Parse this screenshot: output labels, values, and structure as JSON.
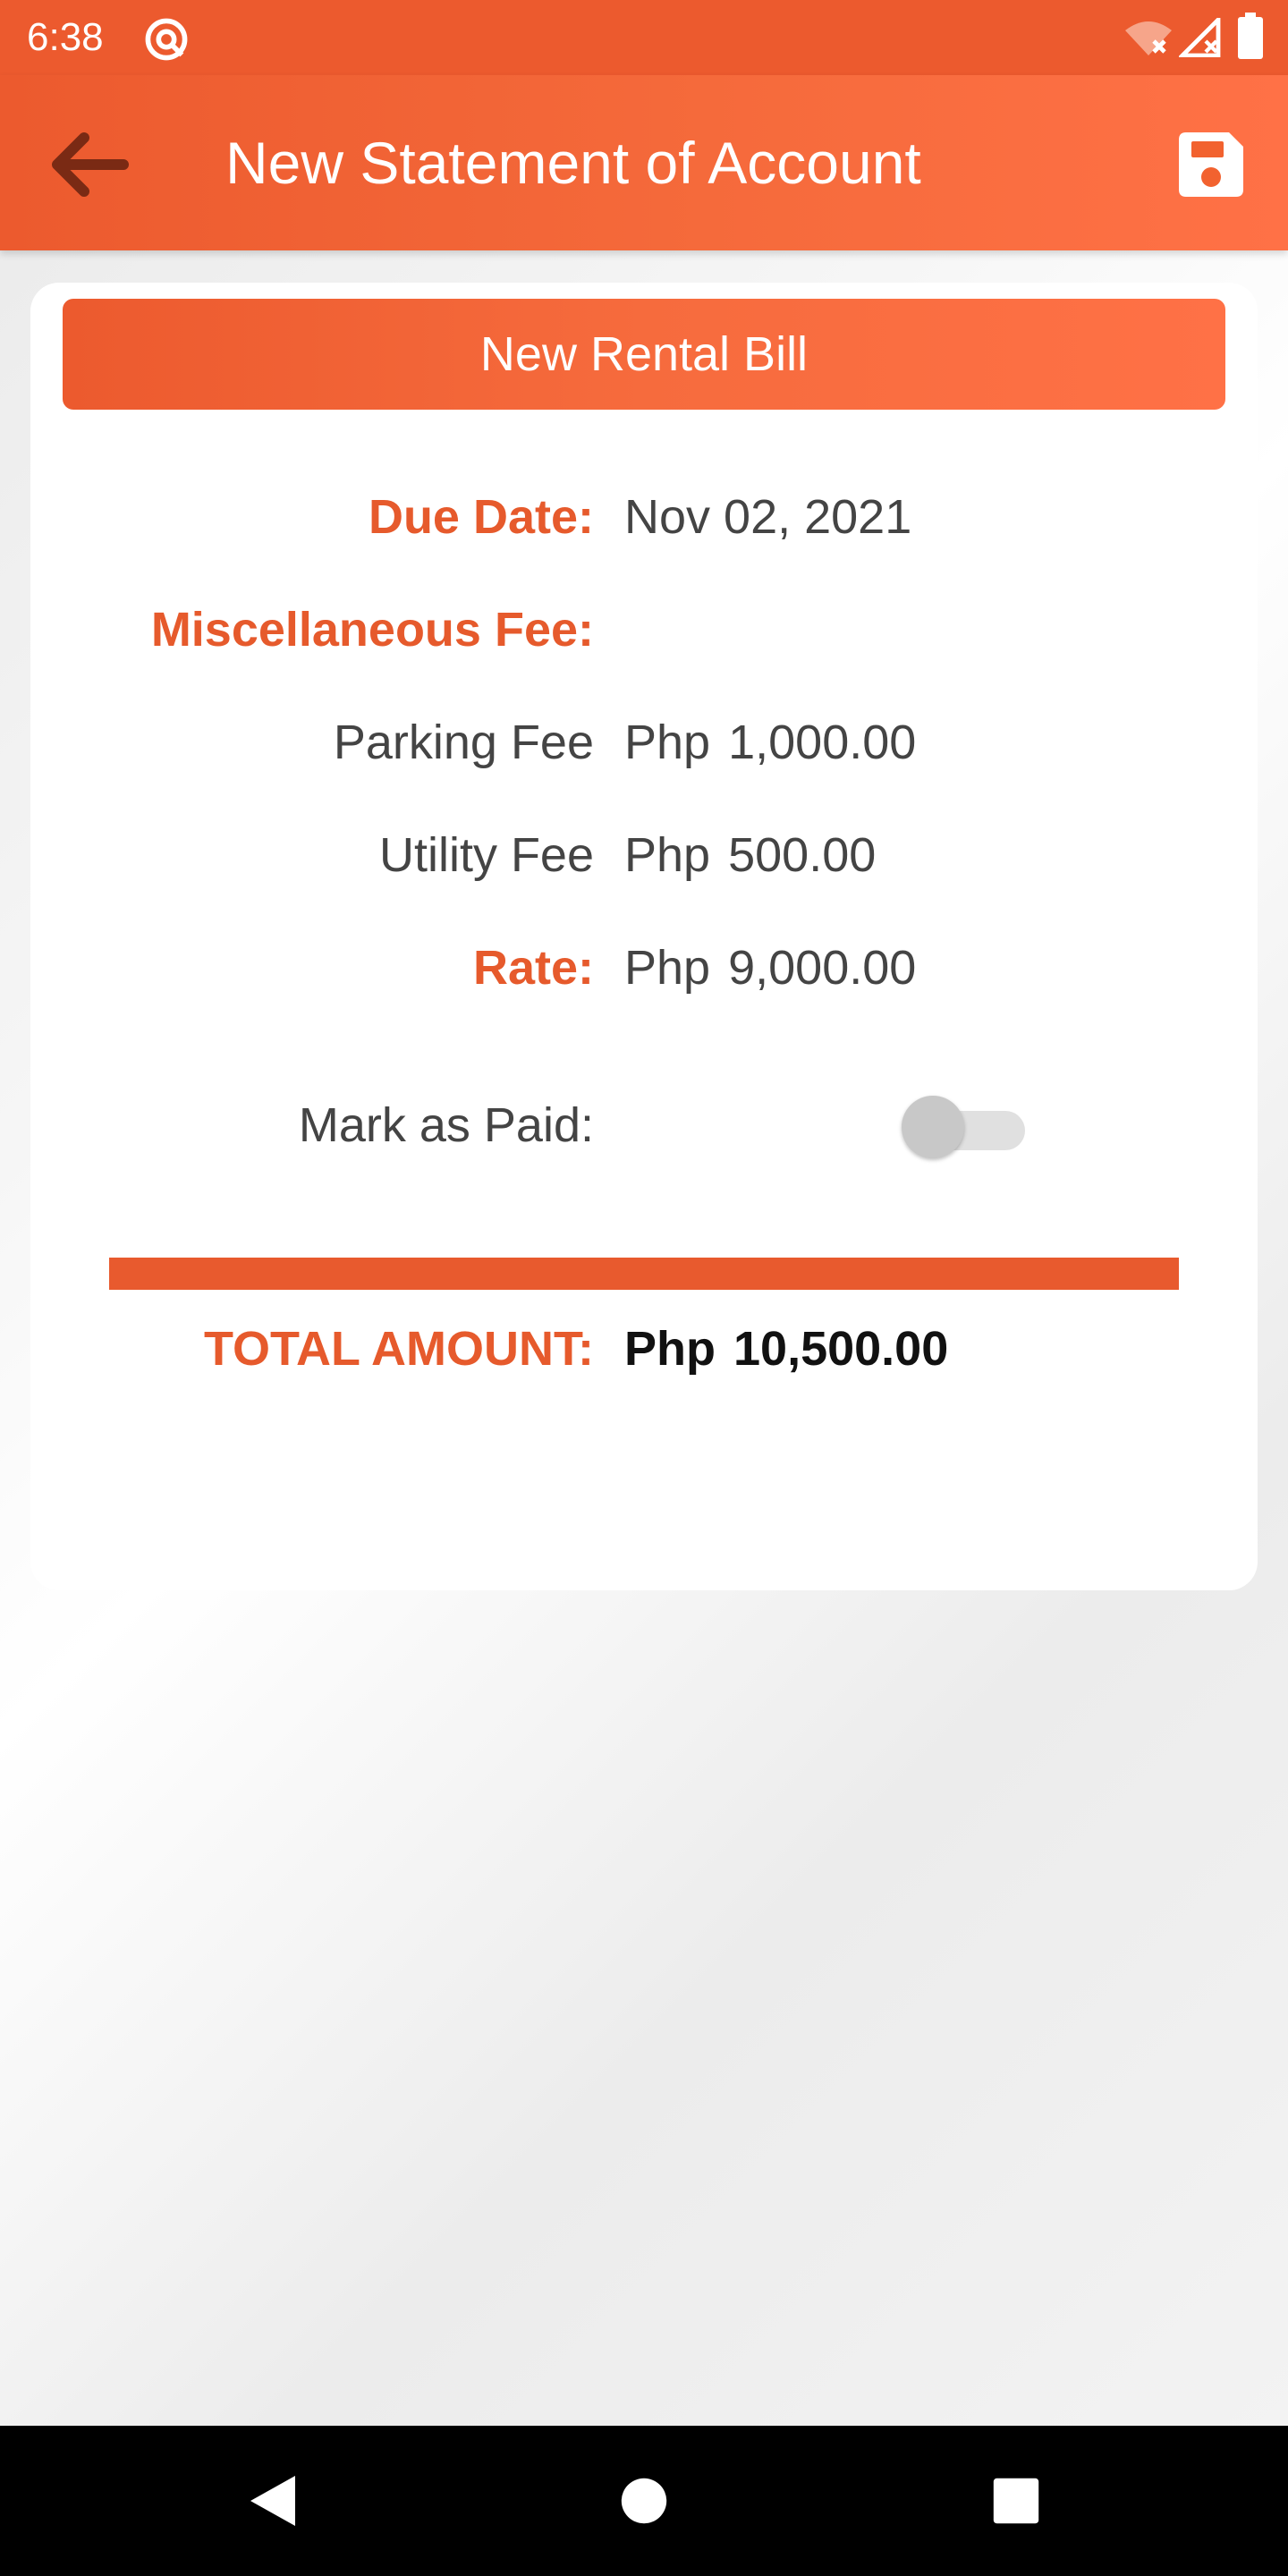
{
  "status_bar": {
    "time": "6:38",
    "app_icon": "at-sign-icon",
    "wifi_icon": "wifi-off-icon",
    "signal_icon": "signal-off-icon",
    "battery_icon": "battery-icon"
  },
  "app_bar": {
    "back_icon": "arrow-back-icon",
    "title": "New Statement of Account",
    "save_icon": "save-icon"
  },
  "bill": {
    "header_button": "New Rental Bill",
    "due_date_label": "Due Date:",
    "due_date_value": "Nov 02, 2021",
    "misc_fee_label": "Miscellaneous Fee:",
    "parking_fee_label": "Parking Fee",
    "parking_fee_currency": "Php",
    "parking_fee_amount": "1,000.00",
    "utility_fee_label": "Utility Fee",
    "utility_fee_currency": "Php",
    "utility_fee_amount": "500.00",
    "rate_label": "Rate:",
    "rate_currency": "Php",
    "rate_amount": "9,000.00",
    "mark_paid_label": "Mark as Paid:",
    "mark_paid": false,
    "total_label": "TOTAL AMOUNT:",
    "total_currency": "Php",
    "total_amount": "10,500.00"
  },
  "nav_bar": {
    "back": "nav-back-icon",
    "home": "nav-home-icon",
    "recents": "nav-recents-icon"
  },
  "colors": {
    "accent": "#ec5a2e",
    "accent_light": "#ff7146",
    "label_accent": "#e65a2c",
    "text": "#444444"
  }
}
